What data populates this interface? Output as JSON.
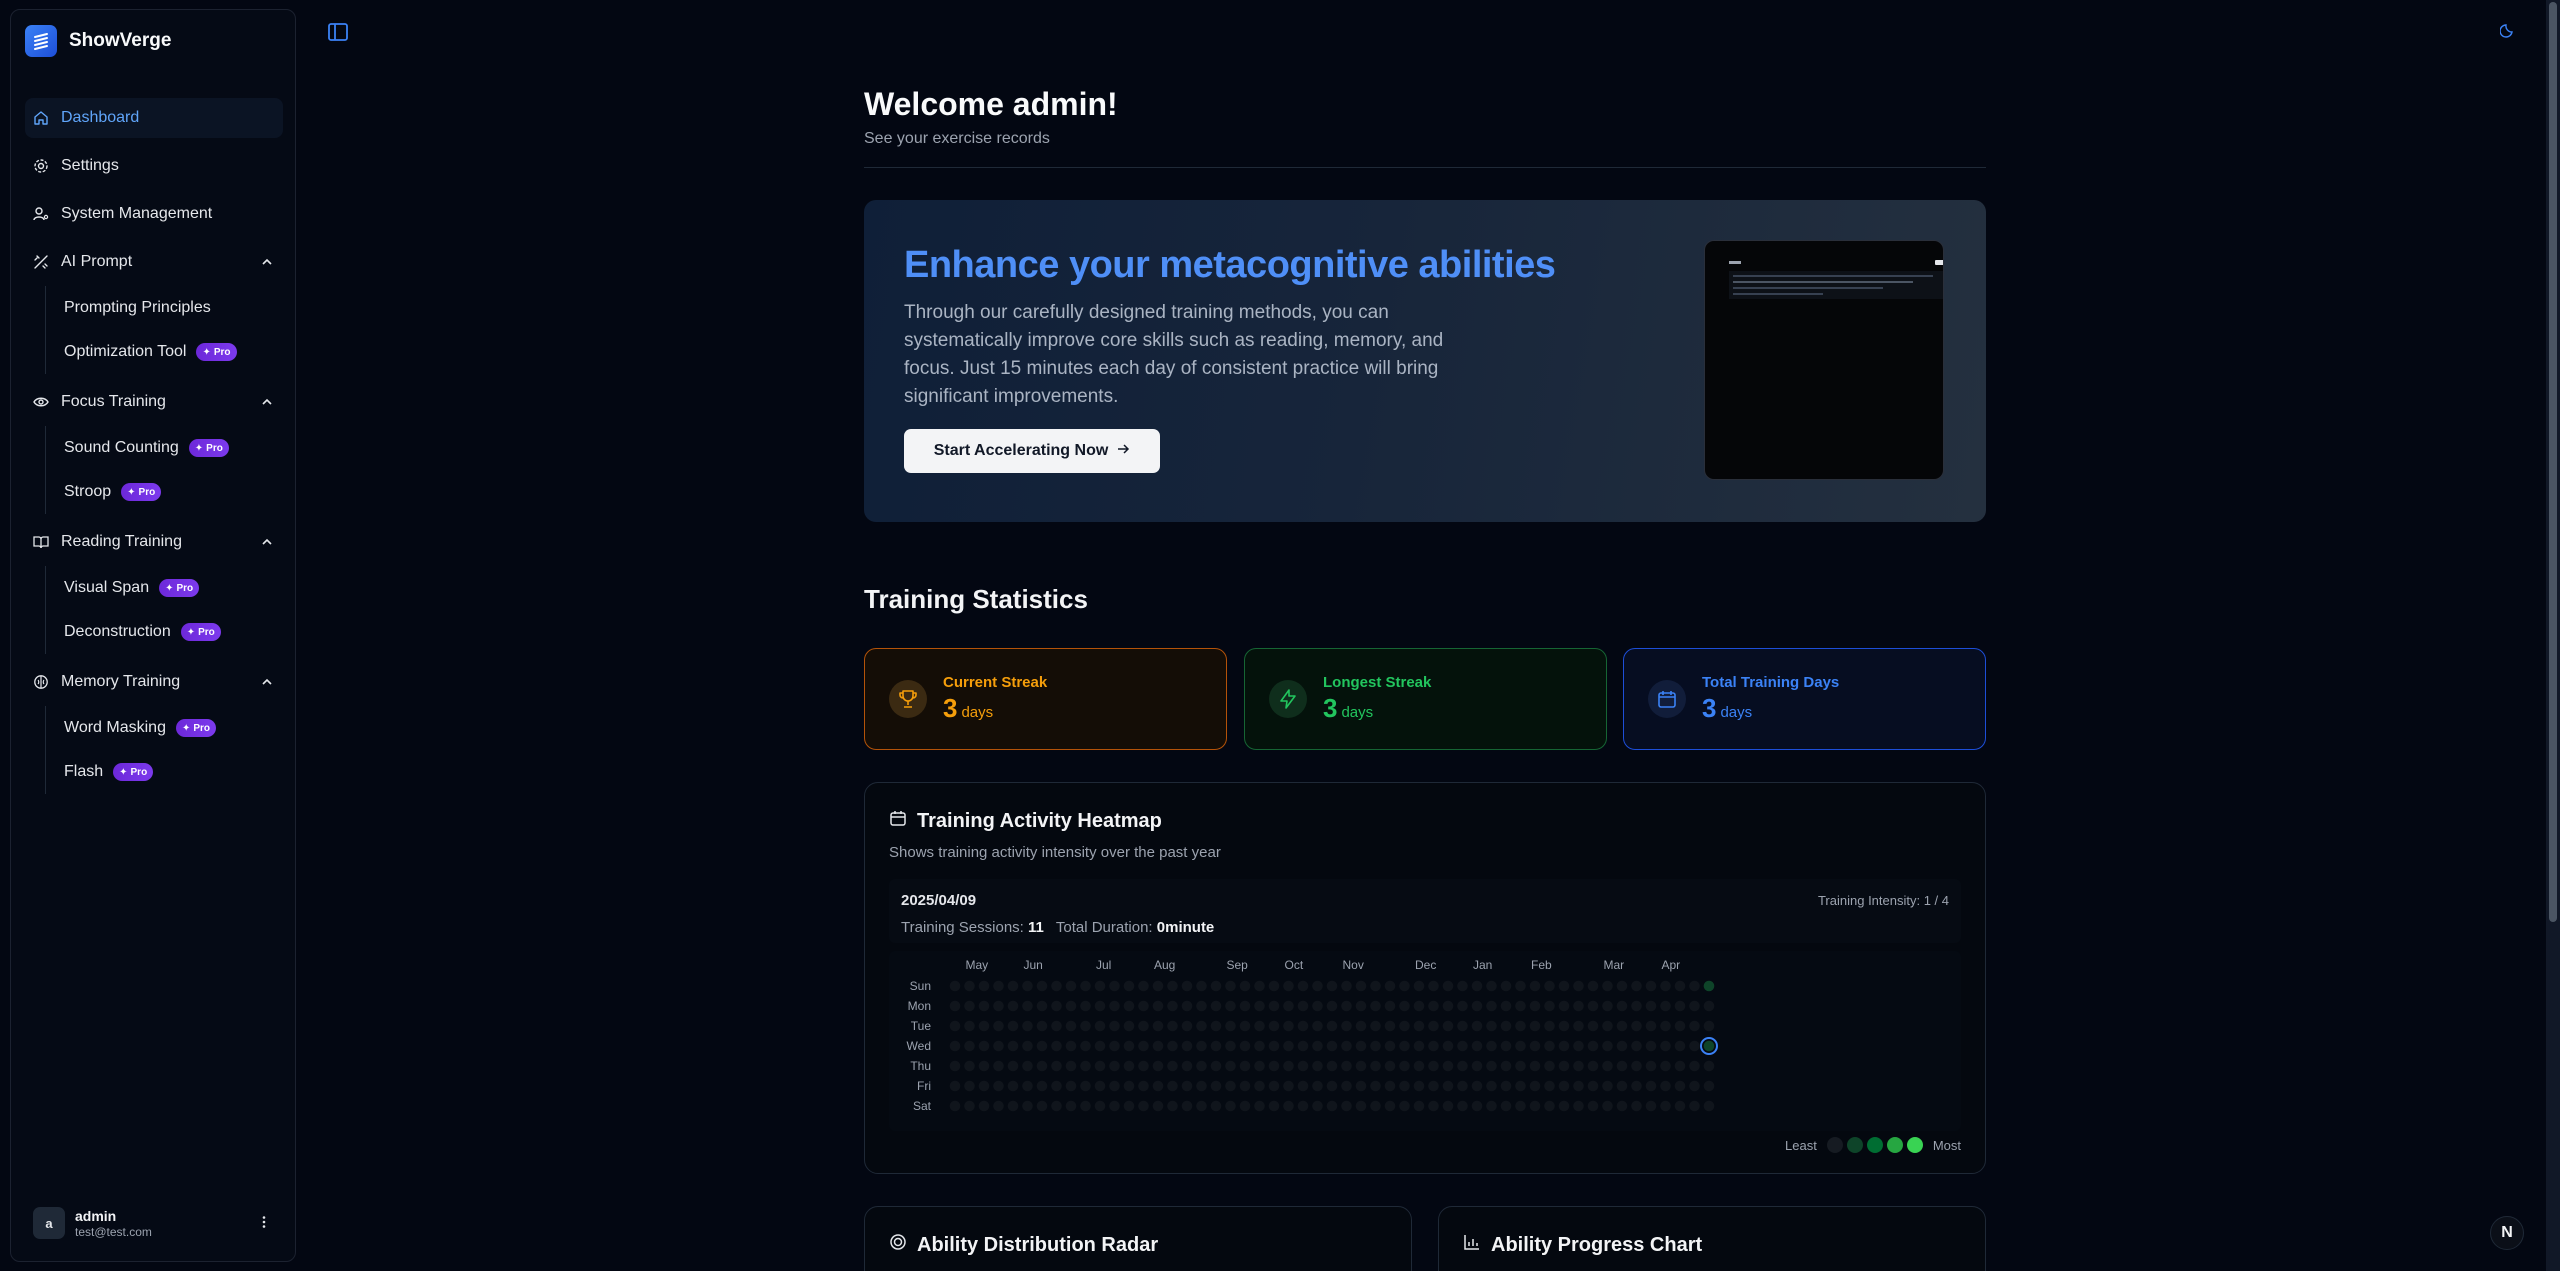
{
  "app": {
    "name": "ShowVerge"
  },
  "sidebar": {
    "nav": [
      {
        "label": "Dashboard"
      },
      {
        "label": "Settings"
      },
      {
        "label": "System Management"
      }
    ],
    "groups": [
      {
        "label": "AI Prompt",
        "items": [
          {
            "label": "Prompting Principles",
            "pro": false
          },
          {
            "label": "Optimization Tool",
            "pro": true
          }
        ]
      },
      {
        "label": "Focus Training",
        "items": [
          {
            "label": "Sound Counting",
            "pro": true
          },
          {
            "label": "Stroop",
            "pro": true
          }
        ]
      },
      {
        "label": "Reading Training",
        "items": [
          {
            "label": "Visual Span",
            "pro": true
          },
          {
            "label": "Deconstruction",
            "pro": true
          }
        ]
      },
      {
        "label": "Memory Training",
        "items": [
          {
            "label": "Word Masking",
            "pro": true
          },
          {
            "label": "Flash",
            "pro": true
          }
        ]
      }
    ],
    "pro_label": "Pro",
    "user": {
      "avatar_initial": "a",
      "name": "admin",
      "email": "test@test.com"
    }
  },
  "header": {
    "title": "Welcome admin!",
    "subtitle": "See your exercise records"
  },
  "hero": {
    "title": "Enhance your metacognitive abilities",
    "text": "Through our carefully designed training methods, you can systematically improve core skills such as reading, memory, and focus. Just 15 minutes each day of consistent practice will bring significant improvements.",
    "button_label": "Start Accelerating Now"
  },
  "stats": {
    "title": "Training Statistics",
    "cards": [
      {
        "label": "Current Streak",
        "value": "3",
        "unit": "days",
        "color": "#f59e0b"
      },
      {
        "label": "Longest Streak",
        "value": "3",
        "unit": "days",
        "color": "#22c55e"
      },
      {
        "label": "Total Training Days",
        "value": "3",
        "unit": "days",
        "color": "#3b82f6"
      }
    ]
  },
  "heatmap": {
    "title": "Training Activity Heatmap",
    "subtitle": "Shows training activity intensity over the past year",
    "selected_date": "2025/04/09",
    "intensity_label": "Training Intensity: 1 / 4",
    "sessions_label": "Training Sessions:",
    "sessions_value": "11",
    "duration_label": "Total Duration:",
    "duration_value": "0minute",
    "months": [
      "May",
      "Jun",
      "Jul",
      "Aug",
      "Sep",
      "Oct",
      "Nov",
      "Dec",
      "Jan",
      "Feb",
      "Mar",
      "Apr"
    ],
    "days": [
      "Sun",
      "Mon",
      "Tue",
      "Wed",
      "Thu",
      "Fri",
      "Sat"
    ],
    "legend_least": "Least",
    "legend_most": "Most",
    "legend_colors": [
      "#161b22",
      "#0e4429",
      "#006d32",
      "#26a641",
      "#39d353"
    ],
    "active_cells": [
      {
        "week": 52,
        "day": 0,
        "level": 1
      },
      {
        "week": 52,
        "day": 3,
        "level": 1
      }
    ]
  },
  "bottom": {
    "radar_title": "Ability Distribution Radar",
    "progress_title": "Ability Progress Chart"
  },
  "corner_badge": "N"
}
